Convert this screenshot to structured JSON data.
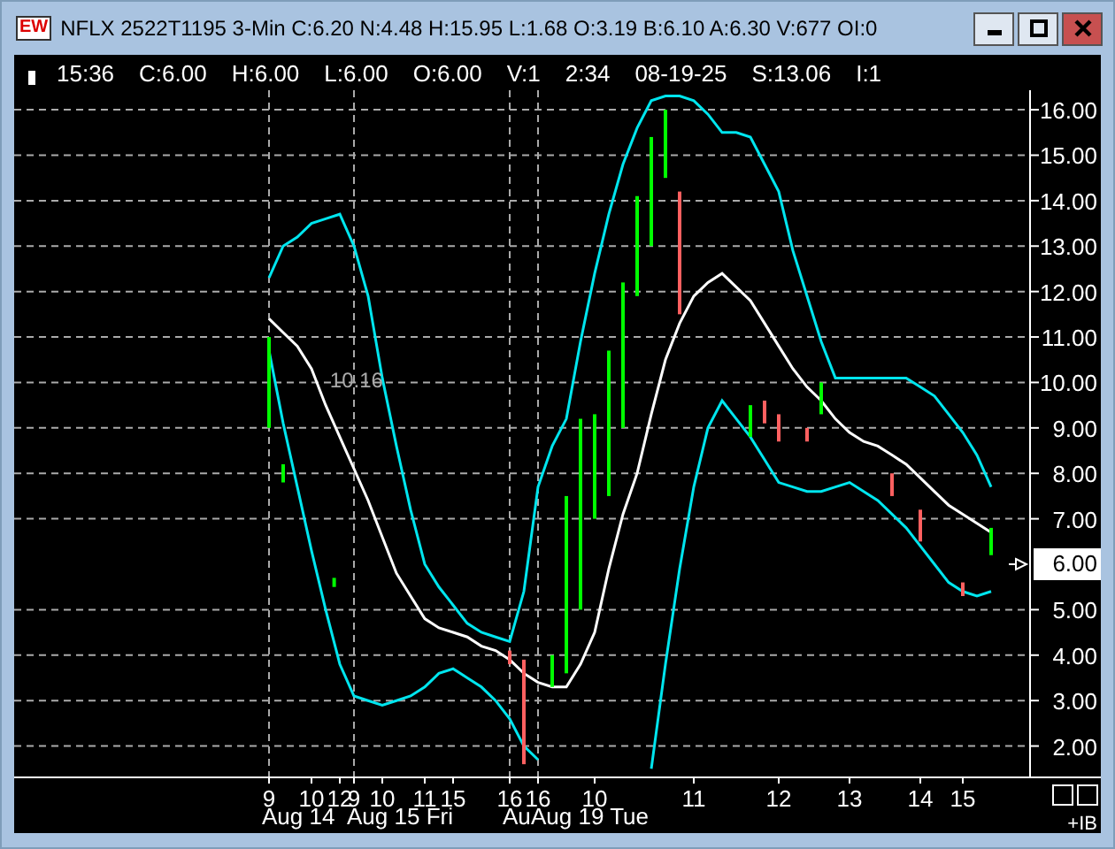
{
  "window": {
    "logo": "EW",
    "title": "NFLX 2522T1195 3-Min C:6.20 N:4.48 H:15.95 L:1.68 O:3.19 B:6.10 A:6.30 V:677 OI:0"
  },
  "info_bar": [
    "15:36",
    "C:6.00",
    "H:6.00",
    "L:6.00",
    "O:6.00",
    "V:1",
    "2:34",
    "08-19-25",
    "S:13.06",
    "I:1"
  ],
  "chart": {
    "chart_data": {
      "type": "line",
      "categories": [
        "9",
        null,
        null,
        "10",
        null,
        "12",
        "9",
        null,
        "10",
        null,
        null,
        "11",
        null,
        "15",
        null,
        null,
        null,
        "16",
        null,
        "16",
        null,
        null,
        null,
        "10",
        null,
        null,
        null,
        null,
        null,
        null,
        "11",
        null,
        null,
        null,
        null,
        null,
        "12",
        null,
        null,
        null,
        null,
        "13",
        null,
        null,
        null,
        null,
        "14",
        null,
        null,
        "15",
        null,
        null
      ],
      "series": [
        {
          "color": "#00e5ee",
          "values": [
            12.3,
            13.0,
            13.2,
            13.5,
            13.6,
            13.7,
            13.0,
            11.9,
            10.1,
            8.6,
            7.2,
            6.0,
            5.5,
            5.1,
            4.7,
            4.5,
            4.4,
            4.3,
            5.4,
            7.7,
            8.6,
            9.2,
            10.9,
            12.4,
            13.7,
            14.8,
            15.6,
            16.2,
            16.3,
            16.3,
            16.2,
            15.9,
            15.5,
            15.5,
            15.4,
            14.8,
            14.2,
            12.9,
            11.9,
            10.9,
            10.1,
            10.1,
            10.1,
            10.1,
            10.1,
            10.1,
            9.9,
            9.7,
            9.3,
            8.9,
            8.4,
            7.7
          ]
        },
        {
          "color": "#ffffff",
          "values": [
            11.4,
            11.1,
            10.8,
            10.3,
            9.5,
            8.8,
            8.1,
            7.4,
            6.6,
            5.8,
            5.3,
            4.8,
            4.6,
            4.5,
            4.4,
            4.2,
            4.1,
            3.9,
            3.6,
            3.4,
            3.3,
            3.3,
            3.8,
            4.5,
            5.9,
            7.1,
            8.0,
            9.3,
            10.5,
            11.3,
            11.9,
            12.2,
            12.4,
            12.1,
            11.8,
            11.3,
            10.8,
            10.3,
            9.9,
            9.6,
            9.2,
            8.9,
            8.7,
            8.6,
            8.4,
            8.2,
            7.9,
            7.6,
            7.3,
            7.1,
            6.9,
            6.7
          ]
        },
        {
          "color": "#00e5ee",
          "values": [
            10.7,
            9.1,
            7.7,
            6.3,
            5.0,
            3.8,
            3.1,
            3.0,
            2.9,
            3.0,
            3.1,
            3.3,
            3.6,
            3.7,
            3.5,
            3.3,
            3.0,
            2.6,
            2.0,
            1.7,
            null,
            null,
            null,
            null,
            null,
            null,
            null,
            1.5,
            3.8,
            5.9,
            7.7,
            9.0,
            9.6,
            9.2,
            8.8,
            8.3,
            7.8,
            7.7,
            7.6,
            7.6,
            7.7,
            7.8,
            7.6,
            7.4,
            7.1,
            6.8,
            6.4,
            6.0,
            5.6,
            5.4,
            5.3,
            5.4
          ]
        }
      ],
      "ylim": [
        1.33,
        16.43
      ],
      "grid": true,
      "yticks": [
        {
          "value": 16,
          "label": "16.00"
        },
        {
          "value": 15,
          "label": "15.00"
        },
        {
          "value": 14,
          "label": "14.00"
        },
        {
          "value": 13,
          "label": "13.00"
        },
        {
          "value": 12,
          "label": "12.00"
        },
        {
          "value": 11,
          "label": "11.00"
        },
        {
          "value": 10,
          "label": "10.00"
        },
        {
          "value": 9,
          "label": "9.00"
        },
        {
          "value": 8,
          "label": "8.00"
        },
        {
          "value": 7,
          "label": "7.00"
        },
        {
          "value": 5,
          "label": "5.00"
        },
        {
          "value": 4,
          "label": "4.00"
        },
        {
          "value": 3,
          "label": "3.00"
        },
        {
          "value": 2,
          "label": "2.00"
        }
      ],
      "annotations": [
        "10.16"
      ]
    },
    "price_marker": "6.00",
    "dates": [
      "Aug 14",
      "Aug 15 Fri",
      "Au",
      "Aug 19 Tue"
    ],
    "corner_label": "+IB"
  }
}
